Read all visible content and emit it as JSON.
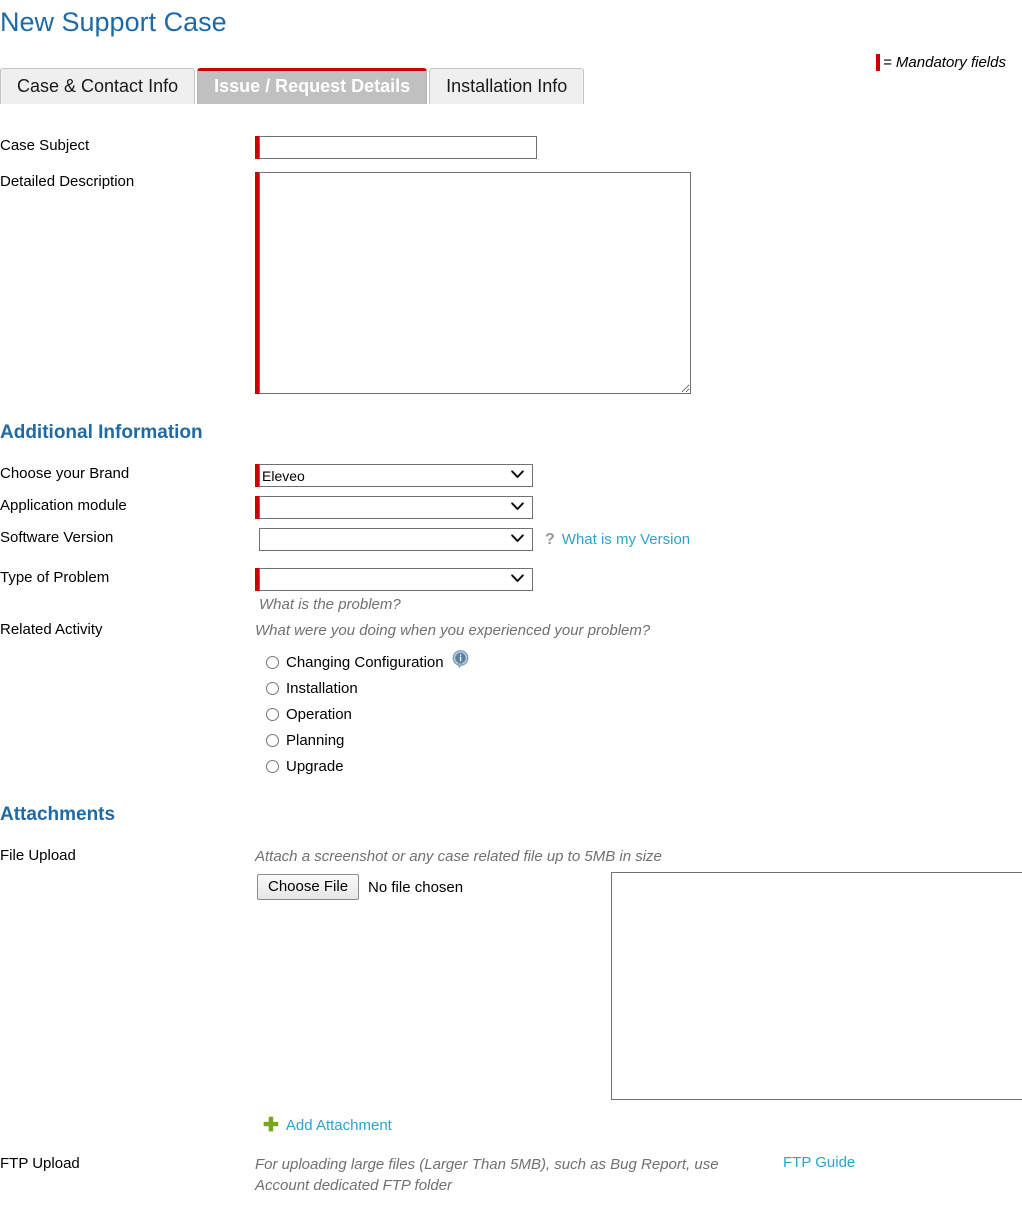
{
  "page": {
    "title": "New Support Case"
  },
  "legend": {
    "text": "= Mandatory fields",
    "marker_color": "#CC0000"
  },
  "tabs": [
    {
      "label": "Case & Contact Info",
      "active": false
    },
    {
      "label": "Issue / Request Details",
      "active": true
    },
    {
      "label": "Installation Info",
      "active": false
    }
  ],
  "issue_details": {
    "case_subject": {
      "label": "Case Subject",
      "value": "",
      "placeholder": "",
      "mandatory": true
    },
    "detailed_description": {
      "label": "Detailed Description",
      "value": "",
      "placeholder": "",
      "mandatory": true
    }
  },
  "additional_information": {
    "heading": "Additional Information",
    "brand": {
      "label": "Choose your Brand",
      "selected": "Eleveo",
      "options": [
        "Eleveo"
      ],
      "mandatory": true
    },
    "application_module": {
      "label": "Application module",
      "selected": "",
      "options": [
        ""
      ],
      "mandatory": true
    },
    "software_version": {
      "label": "Software Version",
      "selected": "",
      "options": [
        ""
      ],
      "mandatory": false,
      "help_icon": "question-mark-icon",
      "help_link": "What is my Version"
    },
    "type_of_problem": {
      "label": "Type of Problem",
      "selected": "",
      "options": [
        ""
      ],
      "mandatory": true,
      "hint": "What is the problem?"
    },
    "related_activity": {
      "label": "Related Activity",
      "hint": "What were you doing when you experienced your problem?",
      "options": [
        {
          "label": "Changing Configuration",
          "selected": false,
          "info_icon": "info-bubble-icon"
        },
        {
          "label": "Installation",
          "selected": false
        },
        {
          "label": "Operation",
          "selected": false
        },
        {
          "label": "Planning",
          "selected": false
        },
        {
          "label": "Upgrade",
          "selected": false
        }
      ]
    }
  },
  "attachments": {
    "heading": "Attachments",
    "file_upload": {
      "label": "File Upload",
      "hint": "Attach a screenshot or any case related file up to 5MB in size",
      "choose_button": "Choose File",
      "file_status": "No file chosen",
      "add_link": "Add Attachment",
      "add_icon": "plus-icon"
    },
    "ftp_upload": {
      "label": "FTP Upload",
      "hint": "For uploading large files (Larger Than 5MB), such as Bug Report, use Account dedicated FTP folder",
      "guide_link": "FTP Guide"
    }
  },
  "colors": {
    "title_blue": "#1F6AA5",
    "link_cyan": "#2BA3CE",
    "mandatory_red": "#CC0000",
    "plus_green": "#76A71F",
    "active_tab_bg": "#C0C0C0"
  }
}
